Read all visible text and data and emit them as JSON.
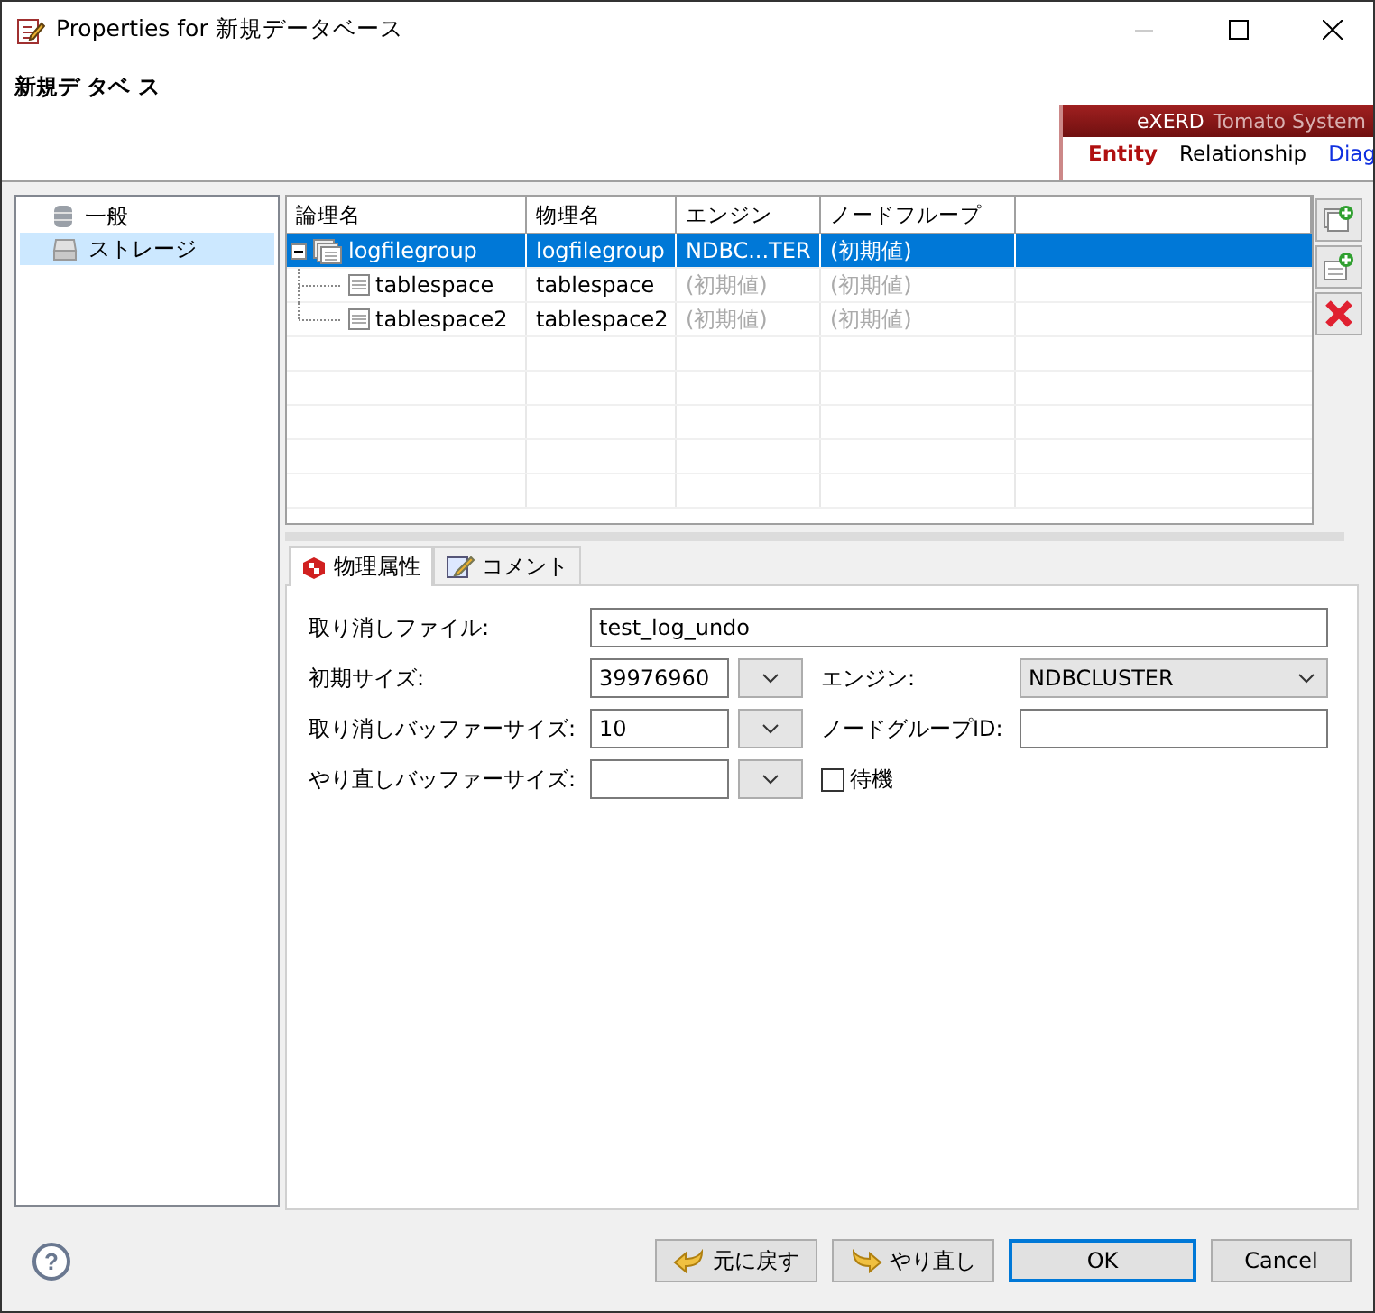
{
  "window": {
    "title": "Properties for 新規データベース"
  },
  "header": {
    "title": "新規デ タベ ス"
  },
  "banner": {
    "brand": "eXERD",
    "product": "Tomato System",
    "tabs": [
      {
        "label": "Entity",
        "selected": true
      },
      {
        "label": "Relationship",
        "selected": false
      },
      {
        "label": "Diag",
        "selected": false
      }
    ]
  },
  "sidebar": {
    "items": [
      {
        "label": "一般",
        "kind": "database",
        "selected": false
      },
      {
        "label": "ストレージ",
        "kind": "storage",
        "selected": true
      }
    ]
  },
  "table": {
    "columns": [
      "論理名",
      "物理名",
      "エンジン",
      "ノードフループ"
    ],
    "rows": [
      {
        "logical": "logfilegroup",
        "physical": "logfilegroup",
        "engine": {
          "text": "NDBC...TER"
        },
        "group": {
          "text": "(初期値)"
        },
        "selected": true,
        "expanded": true,
        "children": [
          {
            "logical": "tablespace",
            "physical": "tablespace",
            "engine": {
              "text": "(初期値)",
              "default": true
            },
            "group": {
              "text": "(初期値)",
              "default": true
            },
            "selected": false
          },
          {
            "logical": "tablespace2",
            "physical": "tablespace2",
            "engine": {
              "text": "(初期値)",
              "default": true
            },
            "group": {
              "text": "(初期値)",
              "default": true
            },
            "selected": false
          }
        ]
      }
    ]
  },
  "tabs": [
    {
      "label": "物理属性",
      "kind": "properties",
      "selected": true
    },
    {
      "label": "コメント",
      "kind": "comment",
      "selected": false
    }
  ],
  "form": {
    "undo_file": {
      "label": "取り消しファイル:",
      "value": "test_log_undo"
    },
    "initial_size": {
      "label": "初期サイズ:",
      "value": "39976960"
    },
    "undo_buffer_size": {
      "label": "取り消しバッファーサイズ:",
      "value": "10"
    },
    "redo_buffer_size": {
      "label": "やり直しバッファーサイズ:"
    },
    "engine": {
      "label": "エンジン:",
      "value": "NDBCLUSTER"
    },
    "node_group_id": {
      "label": "ノードグループID:"
    },
    "wait": {
      "label": "待機",
      "checked": false
    }
  },
  "footer": {
    "help": "?",
    "buttons": [
      {
        "label": "元に戻す",
        "kind": "undo",
        "default": false
      },
      {
        "label": "やり直し",
        "kind": "redo",
        "default": false
      },
      {
        "label": "OK",
        "kind": "plain",
        "default": true
      },
      {
        "label": "Cancel",
        "kind": "plain",
        "default": false
      }
    ]
  }
}
